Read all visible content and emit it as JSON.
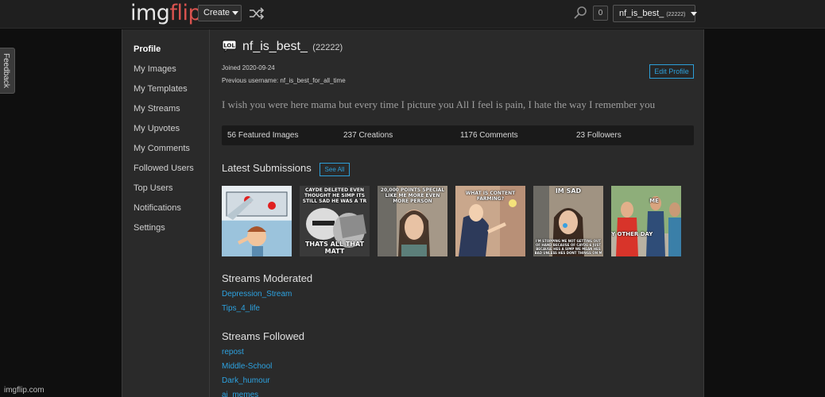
{
  "header": {
    "logo_part1": "img",
    "logo_part2": "flip",
    "create_label": "Create",
    "notification_count": "0",
    "user_label": "nf_is_best_",
    "user_points": "(22222)"
  },
  "feedback_label": "Feedback",
  "sidebar": {
    "items": [
      {
        "label": "Profile"
      },
      {
        "label": "My Images"
      },
      {
        "label": "My Templates"
      },
      {
        "label": "My Streams"
      },
      {
        "label": "My Upvotes"
      },
      {
        "label": "My Comments"
      },
      {
        "label": "Followed Users"
      },
      {
        "label": "Top Users"
      },
      {
        "label": "Notifications"
      },
      {
        "label": "Settings"
      }
    ]
  },
  "profile": {
    "username": "nf_is_best_",
    "points": "(22222)",
    "joined": "Joined 2020-09-24",
    "previous_username": "Previous username: nf_is_best_for_all_time",
    "edit_label": "Edit Profile",
    "bio": "I wish you were here mama but every time I picture you All I feel is pain, I hate the way I remember you"
  },
  "stats": {
    "featured": "56 Featured Images",
    "creations": "237 Creations",
    "comments": "1176 Comments",
    "followers": "23 Followers"
  },
  "submissions": {
    "title": "Latest Submissions",
    "see_all_label": "See All",
    "thumbs": [
      {
        "top": "",
        "bottom": ""
      },
      {
        "top": "CAYDE DELETED EVEN THOUGHT HE SIMP ITS STILL SAD HE WAS A TR",
        "bottom": "THATS ALL THAT MATT"
      },
      {
        "top": "20,000 POINTS SPECIAL LIKE ME MORE EVEN MORE PERSON",
        "bottom": ""
      },
      {
        "top": "WHAT IS CONTENT FARMING?",
        "bottom": ""
      },
      {
        "top": "IM SAD",
        "bottom": "I'M STOPPING ME NOT GETTING OUT OF HAND BECAUSE OF CAYDE-6 JUST BECAUSE HES A SIMP WE MEAN HES BAD UNLESS HES DONT THINGS ON M"
      },
      {
        "top": "ME",
        "bottom": "Y OTHER DAY"
      }
    ]
  },
  "streams_moderated": {
    "title": "Streams Moderated",
    "links": [
      "Depression_Stream",
      "Tips_4_life"
    ]
  },
  "streams_followed": {
    "title": "Streams Followed",
    "links": [
      "repost",
      "Middle-School",
      "Dark_humour",
      "ai_memes"
    ]
  },
  "watermark": "imgflip.com"
}
